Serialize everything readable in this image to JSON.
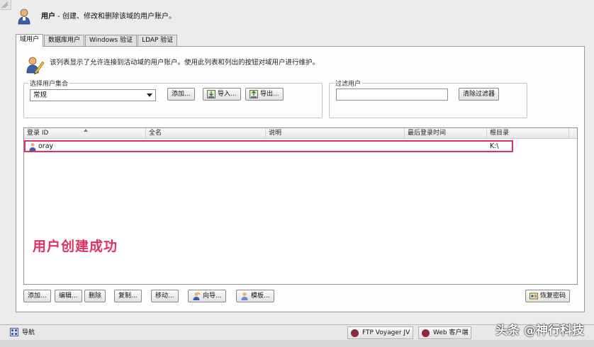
{
  "header": {
    "title_strong": "用户",
    "title_rest": " - 创建、修改和删除该域的用户账户。"
  },
  "tabs": [
    {
      "label": "域用户",
      "active": true
    },
    {
      "label": "数据库用户",
      "active": false
    },
    {
      "label": "Windows 验证",
      "active": false
    },
    {
      "label": "LDAP 验证",
      "active": false
    }
  ],
  "description": "该列表显示了允许连接到活动域的用户账户。使用此列表和列出的按钮对域用户进行维护。",
  "user_set": {
    "label": "选择用户集合",
    "selected": "常规",
    "add_label": "添加...",
    "import_label": "导入...",
    "export_label": "导出..."
  },
  "filter": {
    "label": "过滤用户",
    "value": "",
    "clear_label": "清除过滤器"
  },
  "table": {
    "columns": [
      "登录 ID",
      "全名",
      "说明",
      "最后登录时间",
      "根目录"
    ],
    "rows": [
      {
        "login_id": "oray",
        "full_name": "",
        "description": "",
        "last_login": "",
        "home_dir": "K:\\"
      }
    ]
  },
  "annotation": "用户创建成功",
  "actions": {
    "add": "添加...",
    "edit": "编辑...",
    "delete": "删除",
    "copy": "复制...",
    "move": "移动...",
    "wizard": "向导...",
    "template": "模板...",
    "recover_password": "恢复密码"
  },
  "statusbar": {
    "nav_label": "导航",
    "tasks": [
      "FTP Voyager JV",
      "Web 客户端"
    ]
  },
  "watermark": "头条 @神行科技",
  "colors": {
    "highlight": "#e0325e",
    "panel_bg": "#fdfdfd",
    "window_bg": "#ececec"
  }
}
